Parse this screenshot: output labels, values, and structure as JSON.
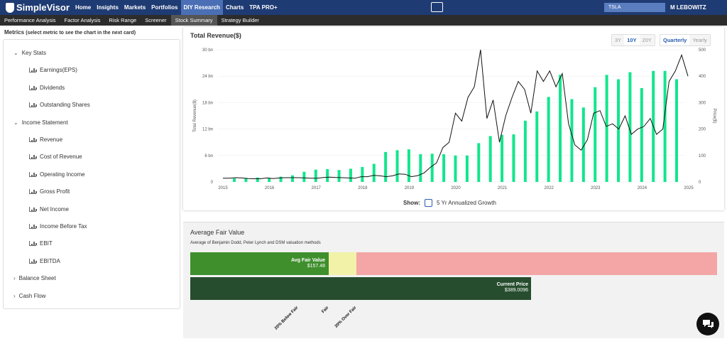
{
  "brand": "SimpleVisor",
  "nav": [
    "Home",
    "Insights",
    "Markets",
    "Portfolios",
    "DIY Research",
    "Charts",
    "TPA PRO+"
  ],
  "nav_active": "DIY Research",
  "search_value": "TSLA",
  "user": "M LEBOWITZ",
  "subnav": [
    "Performance Analysis",
    "Factor Analysis",
    "Risk Range",
    "Screener",
    "Stock Summary",
    "Strategy Builder"
  ],
  "subnav_active": "Stock Summary",
  "metrics_heading": "Metrics",
  "metrics_hint": "(select metric to see the chart in the next card)",
  "tree": [
    {
      "label": "Key Stats",
      "type": "group",
      "open": true
    },
    {
      "label": "Earnings(EPS)",
      "type": "leaf"
    },
    {
      "label": "Dividends",
      "type": "leaf"
    },
    {
      "label": "Outstanding Shares",
      "type": "leaf"
    },
    {
      "label": "Income Statement",
      "type": "group",
      "open": true
    },
    {
      "label": "Revenue",
      "type": "leaf"
    },
    {
      "label": "Cost of Revenue",
      "type": "leaf"
    },
    {
      "label": "Operating Income",
      "type": "leaf"
    },
    {
      "label": "Gross Profit",
      "type": "leaf"
    },
    {
      "label": "Net Income",
      "type": "leaf"
    },
    {
      "label": "Income Before Tax",
      "type": "leaf"
    },
    {
      "label": "EBIT",
      "type": "leaf"
    },
    {
      "label": "EBITDA",
      "type": "leaf"
    },
    {
      "label": "Balance Sheet",
      "type": "group",
      "open": false
    },
    {
      "label": "Cash Flow",
      "type": "group",
      "open": false
    }
  ],
  "chart_title": "Total Revenue($)",
  "range_buttons": [
    "3Y",
    "10Y",
    "20Y"
  ],
  "range_active": "10Y",
  "period_buttons": [
    "Quarterly",
    "Yearly"
  ],
  "period_active": "Quarterly",
  "show_label": "Show:",
  "show_option": "5 Yr Annualized Growth",
  "chart_data": {
    "type": "bar",
    "ylabel": "Total Revenue($)",
    "y2label": "Price($)",
    "ylim": [
      0,
      30
    ],
    "y2lim": [
      0,
      500
    ],
    "yticks": [
      "0",
      "6 bn",
      "12 bn",
      "18 bn",
      "24 bn",
      "30 bn"
    ],
    "y2ticks": [
      "0",
      "100",
      "200",
      "300",
      "400",
      "500"
    ],
    "xticks": [
      "2015",
      "2016",
      "2017",
      "2018",
      "2019",
      "2020",
      "2021",
      "2022",
      "2023",
      "2024",
      "2025"
    ],
    "series": [
      {
        "values": [
          0.8,
          0.9,
          1.0,
          0.9,
          1.2,
          1.5,
          2.3,
          2.8,
          2.9,
          2.7,
          3.0,
          3.4,
          4.1,
          6.8,
          7.2,
          7.4,
          6.3,
          6.4,
          6.3,
          6.0,
          6.0,
          8.8,
          10.4,
          10.7,
          10.8,
          13.9,
          16.0,
          19.3,
          24.3,
          18.8,
          16.9,
          21.5,
          24.3,
          23.3,
          24.9,
          21.3,
          25.2,
          25.2,
          23.3
        ],
        "color": "#12e68c"
      },
      {
        "values": [
          14,
          14,
          16,
          15,
          13,
          12,
          12,
          15,
          13,
          15,
          16,
          16,
          16,
          15,
          14,
          14,
          17,
          18,
          17,
          16,
          15,
          14,
          20,
          20,
          25,
          23,
          20,
          23,
          30,
          29,
          20,
          24,
          34,
          55,
          72,
          130,
          150,
          260,
          230,
          320,
          360,
          500,
          240,
          310,
          150,
          250,
          320,
          380,
          350,
          260,
          420,
          380,
          420,
          360,
          410,
          220,
          140,
          120,
          160,
          260,
          270,
          210,
          220,
          200,
          250,
          180,
          200,
          210,
          240,
          180,
          200,
          380,
          420,
          480,
          400
        ],
        "color": "#111111"
      }
    ]
  },
  "fv_title": "Average Fair Value",
  "fv_sub": "Average of Benjamin Dodd, Peter Lynch and DSM valuation methods",
  "fv_avg_label": "Avg Fair Value",
  "fv_avg_value": "$157.48",
  "fv_cur_label": "Current Price",
  "fv_cur_value": "$389.0096",
  "fv_ticks": [
    "20% Below Fair",
    "Fair",
    "20% Over Fair"
  ]
}
